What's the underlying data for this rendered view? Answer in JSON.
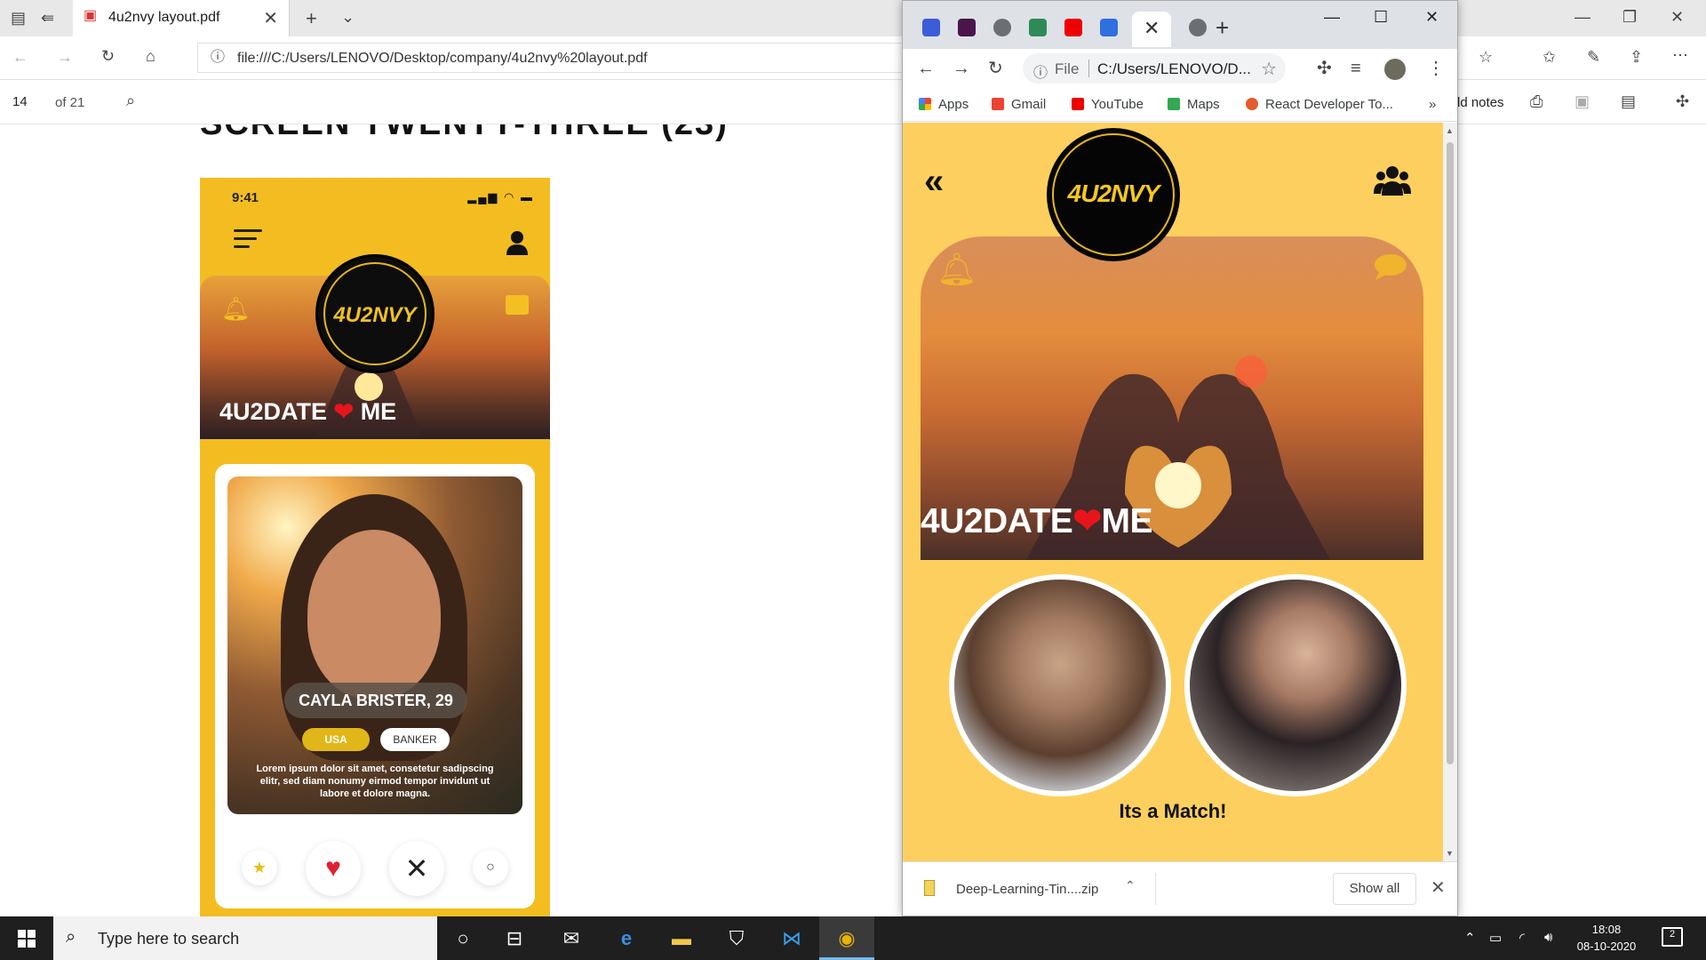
{
  "edge": {
    "tab_title": "4u2nvy layout.pdf",
    "url": "file:///C:/Users/LENOVO/Desktop/company/4u2nvy%20layout.pdf",
    "page_number": "14",
    "page_total": "of 21",
    "notes_label": "ld notes",
    "pdf_heading": "SCREEN TWENTY-THREE (23)",
    "mock": {
      "time": "9:41",
      "logo_text": "4U2NVY",
      "banner_title": "4U2DATE",
      "banner_title_end": "ME",
      "heart": "❤",
      "profile_name": "CAYLA BRISTER, 29",
      "tag_country": "USA",
      "tag_job": "BANKER",
      "description": "Lorem ipsum dolor sit amet, consetetur sadipscing elitr, sed diam nonumy eirmod tempor invidunt ut labore et dolore magna."
    }
  },
  "chrome": {
    "url_scheme": "File",
    "url": "C:/Users/LENOVO/D...",
    "bookmarks": [
      "Apps",
      "Gmail",
      "YouTube",
      "Maps",
      "React Developer To..."
    ],
    "bookmarks_more": "»",
    "app": {
      "logo_text": "4U2NVY",
      "title_start": "4U2DATE",
      "title_end": "ME",
      "heart": "❤",
      "match_text": "Its a Match!"
    },
    "download": {
      "file_name": "Deep-Learning-Tin....zip",
      "show_all": "Show all"
    }
  },
  "taskbar": {
    "search_placeholder": "Type here to search",
    "time": "18:08",
    "date": "08-10-2020",
    "notification_count": "2"
  },
  "colors": {
    "app_bg": "#fdcf5e",
    "mock_bg": "#f3bd22",
    "logo_gold": "#f5c71f",
    "heart_red": "#e8141c"
  }
}
